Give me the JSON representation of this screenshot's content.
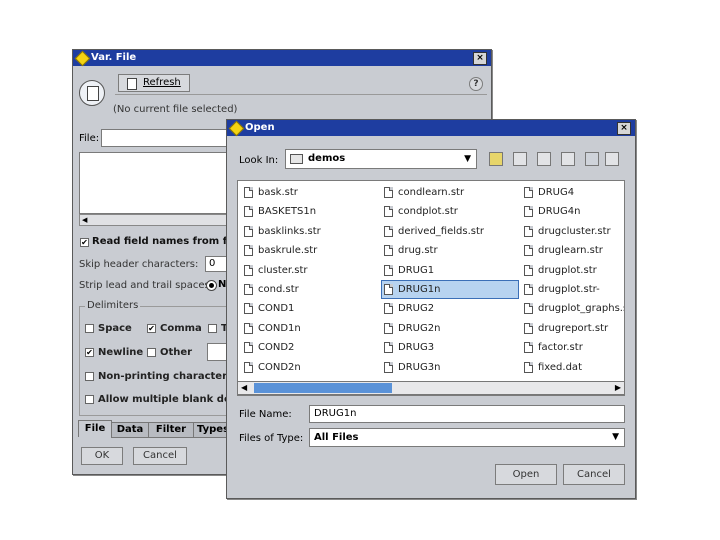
{
  "var_file": {
    "title": "Var. File",
    "close": "×",
    "refresh_label": "Refresh",
    "help": "?",
    "no_file": "(No current file selected)",
    "file_label": "File:",
    "read_field_names": "Read field names from file",
    "skip_header_label": "Skip header characters:",
    "skip_header_value": "0",
    "strip_label": "Strip lead and trail spaces:",
    "strip_value": "N",
    "delimiters_label": "Delimiters",
    "space": "Space",
    "comma": "Comma",
    "tab_short": "T",
    "newline": "Newline",
    "other": "Other",
    "non_printing": "Non-printing characters",
    "allow_multiple": "Allow multiple blank delimi",
    "tabs": [
      "File",
      "Data",
      "Filter",
      "Types"
    ],
    "ok": "OK",
    "cancel": "Cancel"
  },
  "open": {
    "title": "Open",
    "close": "×",
    "look_in_label": "Look In:",
    "look_in_value": "demos",
    "files": [
      [
        "bask.str",
        "BASKETS1n",
        "basklinks.str",
        "baskrule.str",
        "cluster.str",
        "cond.str",
        "COND1",
        "COND1n",
        "COND2",
        "COND2n"
      ],
      [
        "condlearn.str",
        "condplot.str",
        "derived_fields.str",
        "drug.str",
        "DRUG1",
        "DRUG1n",
        "DRUG2",
        "DRUG2n",
        "DRUG3",
        "DRUG3n"
      ],
      [
        "DRUG4",
        "DRUG4n",
        "drugcluster.str",
        "druglearn.str",
        "drugplot.str",
        "drugplot.str-",
        "drugplot_graphs.s",
        "drugreport.str",
        "factor.str",
        "fixed.dat"
      ]
    ],
    "file_name_label": "File Name:",
    "file_name_value": "DRUG1n",
    "files_of_type_label": "Files of Type:",
    "files_of_type_value": "All Files",
    "open_button": "Open",
    "cancel_button": "Cancel",
    "selected_file": "DRUG1n"
  }
}
